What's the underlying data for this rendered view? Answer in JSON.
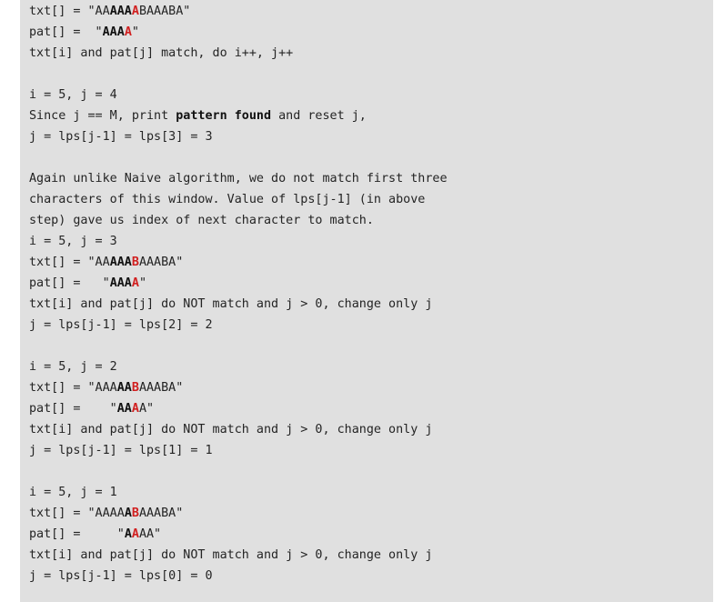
{
  "block": {
    "lines": [
      {
        "segments": [
          {
            "t": "txt[] = \"AA"
          },
          {
            "t": "AAA",
            "s": "b"
          },
          {
            "t": "A",
            "s": "hl"
          },
          {
            "t": "BAAABA\""
          }
        ]
      },
      {
        "segments": [
          {
            "t": "pat[] =  \""
          },
          {
            "t": "AAA",
            "s": "b"
          },
          {
            "t": "A",
            "s": "hl"
          },
          {
            "t": "\""
          }
        ]
      },
      {
        "segments": [
          {
            "t": "txt[i] and pat[j] match, do i++, j++"
          }
        ]
      },
      {
        "segments": []
      },
      {
        "segments": [
          {
            "t": "i = 5, j = 4"
          }
        ]
      },
      {
        "segments": [
          {
            "t": "Since j == M, print "
          },
          {
            "t": "pattern found",
            "s": "b"
          },
          {
            "t": " and reset j,"
          }
        ]
      },
      {
        "segments": [
          {
            "t": "j = lps[j-1] = lps[3] = 3"
          }
        ]
      },
      {
        "segments": []
      },
      {
        "segments": [
          {
            "t": "Again unlike Naive algorithm, we do not match first three"
          }
        ]
      },
      {
        "segments": [
          {
            "t": "characters of this window. Value of lps[j-1] (in above"
          }
        ]
      },
      {
        "segments": [
          {
            "t": "step) gave us index of next character to match."
          }
        ]
      },
      {
        "segments": [
          {
            "t": "i = 5, j = 3"
          }
        ]
      },
      {
        "segments": [
          {
            "t": "txt[] = \"AA"
          },
          {
            "t": "AAA",
            "s": "b"
          },
          {
            "t": "B",
            "s": "hl"
          },
          {
            "t": "AAABA\""
          }
        ]
      },
      {
        "segments": [
          {
            "t": "pat[] =   \""
          },
          {
            "t": "AAA",
            "s": "b"
          },
          {
            "t": "A",
            "s": "hl"
          },
          {
            "t": "\""
          }
        ]
      },
      {
        "segments": [
          {
            "t": "txt[i] and pat[j] do NOT match and j > 0, change only j"
          }
        ]
      },
      {
        "segments": [
          {
            "t": "j = lps[j-1] = lps[2] = 2"
          }
        ]
      },
      {
        "segments": []
      },
      {
        "segments": [
          {
            "t": "i = 5, j = 2"
          }
        ]
      },
      {
        "segments": [
          {
            "t": "txt[] = \"AAA"
          },
          {
            "t": "AA",
            "s": "b"
          },
          {
            "t": "B",
            "s": "hl"
          },
          {
            "t": "AAABA\""
          }
        ]
      },
      {
        "segments": [
          {
            "t": "pat[] =    \""
          },
          {
            "t": "AA",
            "s": "b"
          },
          {
            "t": "A",
            "s": "hl"
          },
          {
            "t": "A\""
          }
        ]
      },
      {
        "segments": [
          {
            "t": "txt[i] and pat[j] do NOT match and j > 0, change only j"
          }
        ]
      },
      {
        "segments": [
          {
            "t": "j = lps[j-1] = lps[1] = 1"
          }
        ]
      },
      {
        "segments": []
      },
      {
        "segments": [
          {
            "t": "i = 5, j = 1"
          }
        ]
      },
      {
        "segments": [
          {
            "t": "txt[] = \"AAAA"
          },
          {
            "t": "A",
            "s": "b"
          },
          {
            "t": "B",
            "s": "hl"
          },
          {
            "t": "AAABA\""
          }
        ]
      },
      {
        "segments": [
          {
            "t": "pat[] =     \""
          },
          {
            "t": "A",
            "s": "b"
          },
          {
            "t": "A",
            "s": "hl"
          },
          {
            "t": "AA\""
          }
        ]
      },
      {
        "segments": [
          {
            "t": "txt[i] and pat[j] do NOT match and j > 0, change only j"
          }
        ]
      },
      {
        "segments": [
          {
            "t": "j = lps[j-1] = lps[0] = 0"
          }
        ]
      }
    ]
  }
}
